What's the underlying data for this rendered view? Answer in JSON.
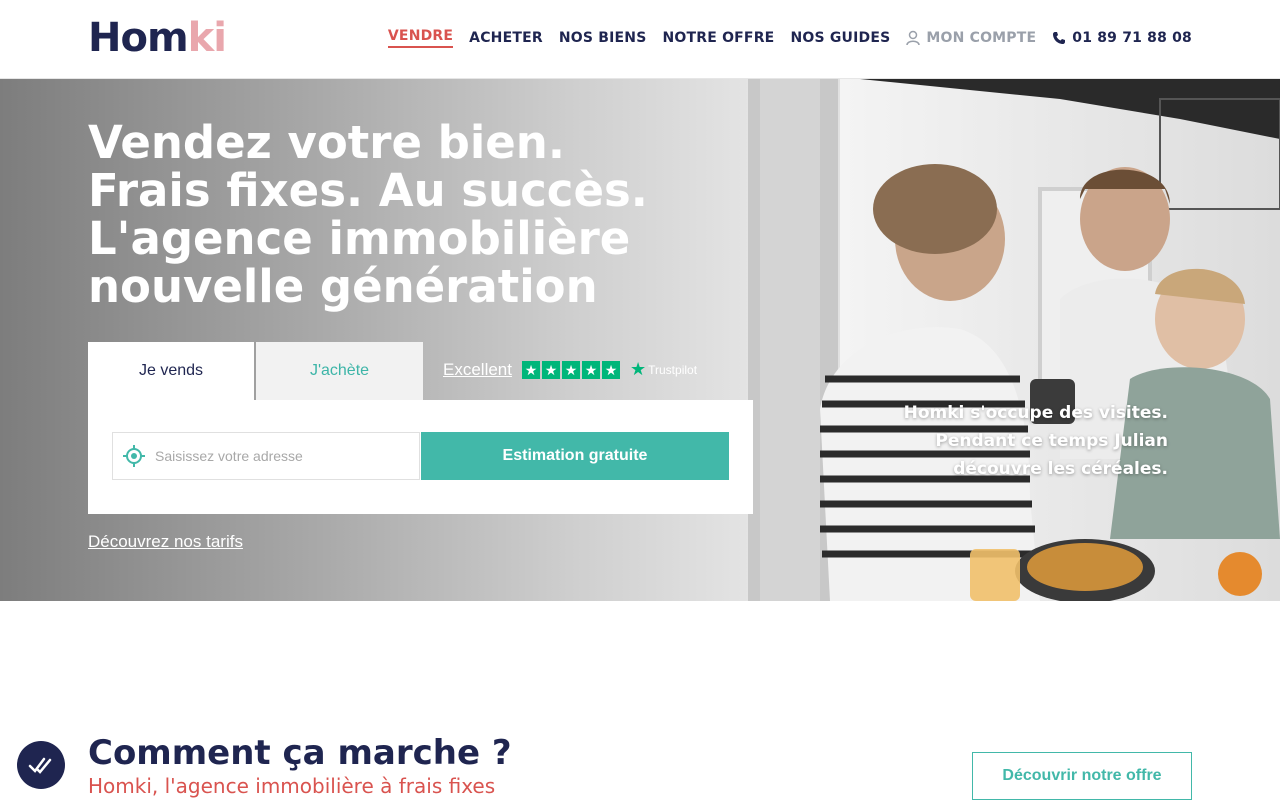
{
  "brand": {
    "logo_part1": "Hom",
    "logo_part2": "ki",
    "accent": "#42b8a9",
    "navy": "#1f2550",
    "red": "#d9534f"
  },
  "nav": {
    "items": [
      "VENDRE",
      "ACHETER",
      "NOS BIENS",
      "NOTRE OFFRE",
      "NOS GUIDES"
    ],
    "active": "VENDRE",
    "account": "MON COMPTE",
    "phone": "01 89 71 88 08"
  },
  "hero": {
    "title": "Vendez votre bien.\nFrais fixes. Au succès.\nL'agence immobilière\nnouvelle génération",
    "tabs": {
      "sell": "Je vends",
      "buy": "J'achète"
    },
    "trust": {
      "rating": "Excellent",
      "brand": "Trustpilot",
      "stars": 5
    },
    "search": {
      "placeholder": "Saisissez votre adresse",
      "button": "Estimation gratuite"
    },
    "tarifs_link": "Découvrez nos tarifs",
    "caption": "Homki s'occupe des visites.\nPendant ce temps Julian\ndécouvre les céréales."
  },
  "how": {
    "title": "Comment ça marche ?",
    "subtitle": "Homki, l'agence immobilière à frais fixes",
    "button": "Découvrir notre offre"
  }
}
